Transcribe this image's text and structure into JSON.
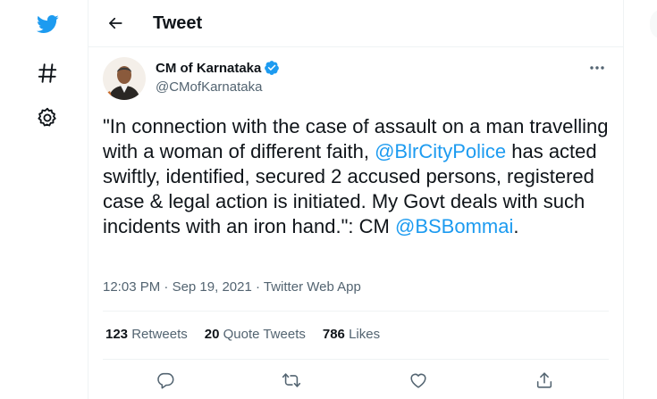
{
  "header": {
    "title": "Tweet"
  },
  "tweet": {
    "author_name": "CM of Karnataka",
    "author_handle": "@CMofKarnataka",
    "text_part1": "\"In connection with the case of assault on a man travelling with a woman of different faith, ",
    "mention1": "@BlrCityPolice",
    "text_part2": "  has acted swiftly, identified, secured 2 accused persons, registered case & legal action is initiated. My Govt deals with such incidents with an iron hand.\": CM ",
    "mention2": "@BSBommai",
    "text_part3": ".",
    "time": "12:03 PM",
    "date": "Sep 19, 2021",
    "source": "Twitter Web App",
    "dot": "·"
  },
  "stats": {
    "retweets_count": "123",
    "retweets_label": "Retweets",
    "quotes_count": "20",
    "quotes_label": "Quote Tweets",
    "likes_count": "786",
    "likes_label": "Likes"
  },
  "colors": {
    "accent": "#1d9bf0",
    "text": "#0f1419",
    "secondary": "#536471",
    "border": "#eff3f4"
  },
  "icons": [
    "twitter-bird-icon",
    "hashtag-icon",
    "gear-icon",
    "back-arrow-icon",
    "verified-badge-icon",
    "more-icon",
    "reply-icon",
    "retweet-icon",
    "like-icon",
    "share-icon"
  ]
}
